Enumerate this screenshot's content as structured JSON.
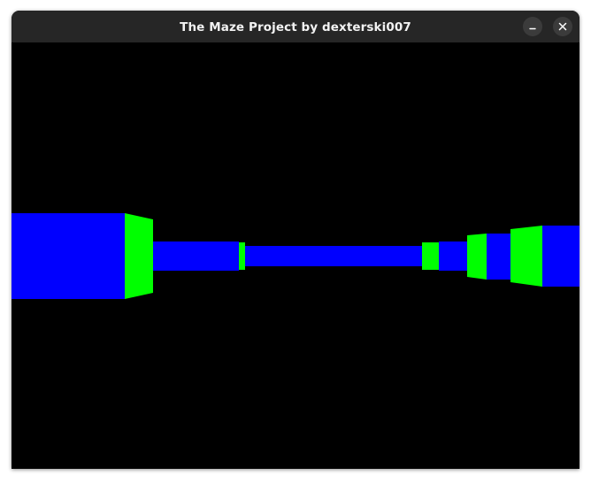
{
  "window": {
    "title": "The Maze Project by dexterski007",
    "controls": {
      "minimize_icon": "minimize-icon",
      "close_icon": "close-icon"
    }
  },
  "scene": {
    "ceiling_color": "#000000",
    "floor_color": "#000000",
    "wall_colors": {
      "near_side": "#0000ff",
      "far_side": "#00ff00"
    }
  }
}
